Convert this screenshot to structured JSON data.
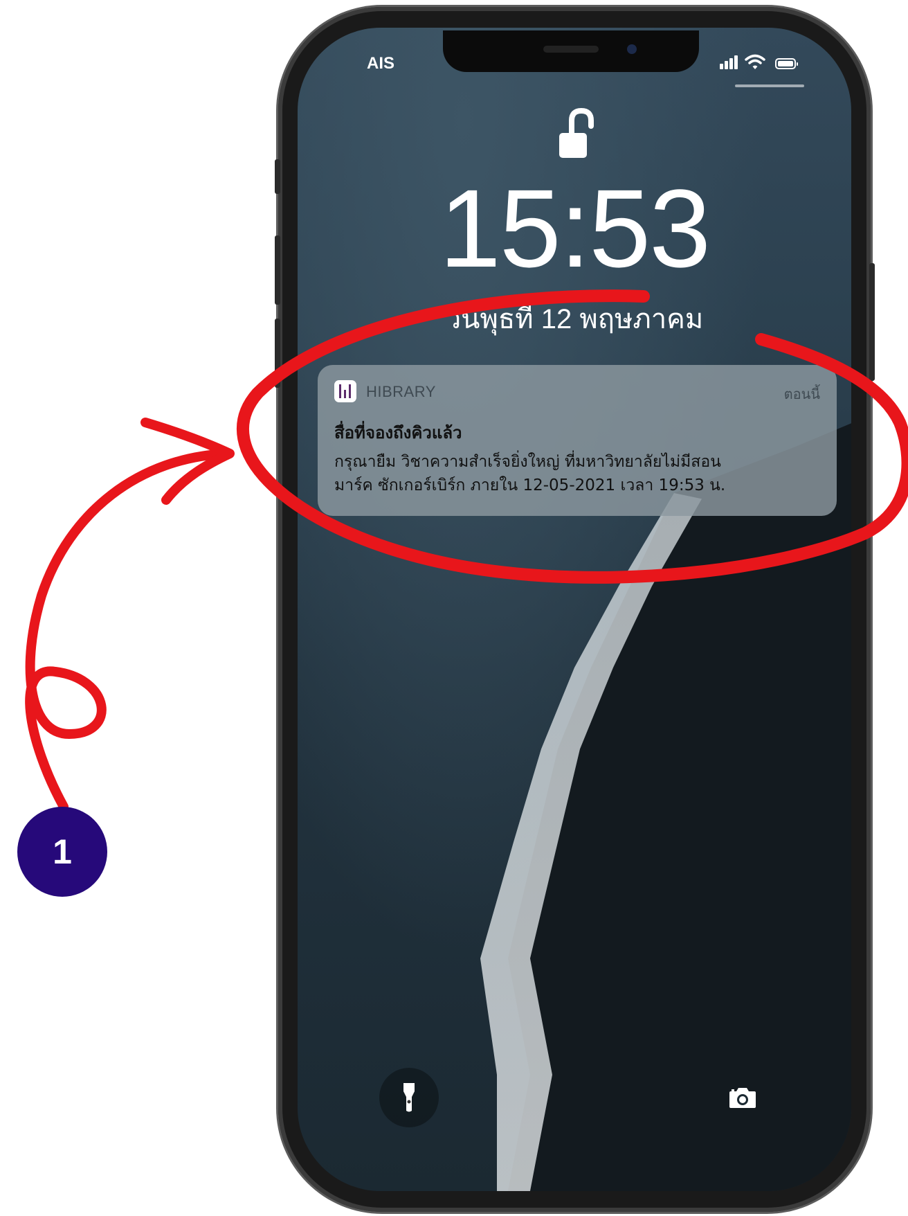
{
  "status_bar": {
    "carrier": "AIS",
    "icons": [
      "signal-bars-icon",
      "wifi-icon",
      "battery-icon"
    ]
  },
  "lock_screen": {
    "lock_icon": "unlocked-padlock-icon",
    "time": "15:53",
    "date": "วันพุธที่ 12 พฤษภาคม"
  },
  "notification": {
    "app_icon": "hibrary-app-icon",
    "app_name": "HIBRARY",
    "time": "ตอนนี้",
    "title": "สื่อที่จองถึงคิวแล้ว",
    "body_line1": "กรุณายืม วิชาความสำเร็จยิ่งใหญ่ ที่มหาวิทยาลัยไม่มีสอน",
    "body_line2": "มาร์ค ซักเกอร์เบิร์ก ภายใน 12-05-2021 เวลา 19:53 น."
  },
  "quick_actions": {
    "left": "flashlight-icon",
    "right": "camera-icon"
  },
  "annotation": {
    "step_number": "1",
    "color": "#e8161b",
    "badge_color": "#26097a"
  }
}
